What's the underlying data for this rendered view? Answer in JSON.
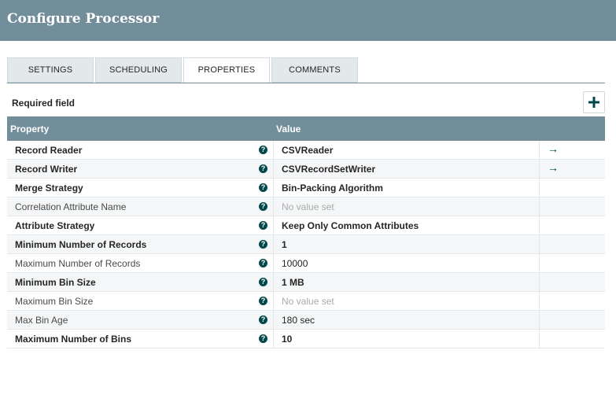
{
  "header": {
    "title": "Configure Processor"
  },
  "tabs": [
    {
      "label": "SETTINGS"
    },
    {
      "label": "SCHEDULING"
    },
    {
      "label": "PROPERTIES"
    },
    {
      "label": "COMMENTS"
    }
  ],
  "active_tab": "PROPERTIES",
  "required_label": "Required field",
  "add_button_icon": "plus-icon",
  "table": {
    "headers": {
      "property": "Property",
      "value": "Value"
    },
    "rows": [
      {
        "name": "Record Reader",
        "value": "CSVReader",
        "required": true,
        "empty": false,
        "link": "→"
      },
      {
        "name": "Record Writer",
        "value": "CSVRecordSetWriter",
        "required": true,
        "empty": false,
        "link": "→"
      },
      {
        "name": "Merge Strategy",
        "value": "Bin-Packing Algorithm",
        "required": true,
        "empty": false
      },
      {
        "name": "Correlation Attribute Name",
        "value": "No value set",
        "required": false,
        "empty": true
      },
      {
        "name": "Attribute Strategy",
        "value": "Keep Only Common Attributes",
        "required": true,
        "empty": false
      },
      {
        "name": "Minimum Number of Records",
        "value": "1",
        "required": true,
        "empty": false
      },
      {
        "name": "Maximum Number of Records",
        "value": "10000",
        "required": false,
        "empty": false
      },
      {
        "name": "Minimum Bin Size",
        "value": "1 MB",
        "required": true,
        "empty": false
      },
      {
        "name": "Maximum Bin Size",
        "value": "No value set",
        "required": false,
        "empty": true
      },
      {
        "name": "Max Bin Age",
        "value": "180 sec",
        "required": false,
        "empty": false
      },
      {
        "name": "Maximum Number of Bins",
        "value": "10",
        "required": true,
        "empty": false
      }
    ]
  },
  "help_icon_glyph": "?",
  "colors": {
    "header_bg": "#728e9b",
    "tab_bg": "#e3e8eb",
    "accent": "#004849",
    "placeholder": "#aaaaaa"
  }
}
